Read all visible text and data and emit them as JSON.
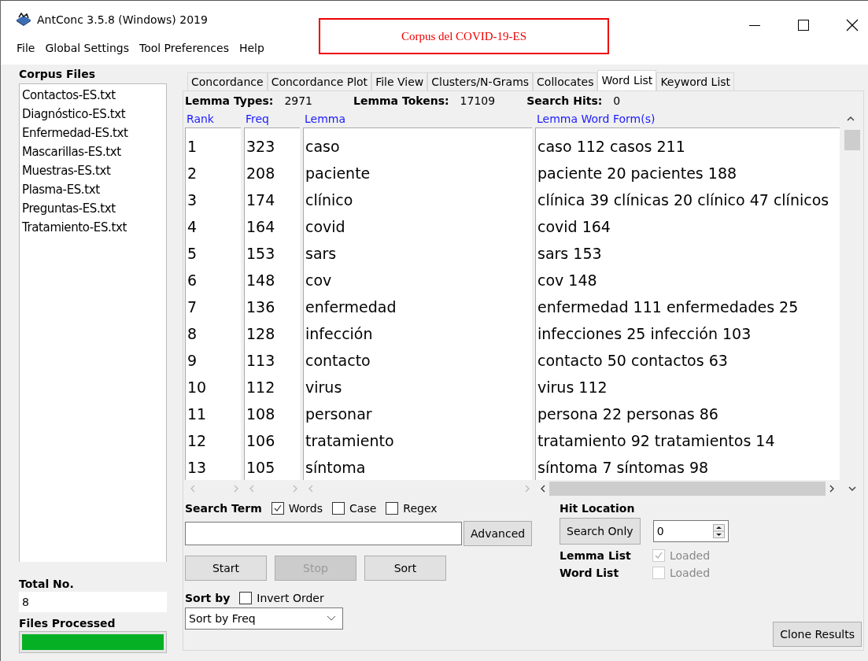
{
  "window": {
    "title": "AntConc 3.5.8 (Windows) 2019"
  },
  "annotation": "Corpus del COVID-19-ES",
  "menu": [
    "File",
    "Global Settings",
    "Tool Preferences",
    "Help"
  ],
  "corpus_files": {
    "title": "Corpus Files",
    "files": [
      "Contactos-ES.txt",
      "Diagnóstico-ES.txt",
      "Enfermedad-ES.txt",
      "Mascarillas-ES.txt",
      "Muestras-ES.txt",
      "Plasma-ES.txt",
      "Preguntas-ES.txt",
      "Tratamiento-ES.txt"
    ]
  },
  "total_no": {
    "label": "Total No.",
    "value": "8"
  },
  "files_processed": {
    "label": "Files Processed",
    "level": 1
  },
  "tabs": [
    {
      "label": "Concordance",
      "selected": false
    },
    {
      "label": "Concordance Plot",
      "selected": false
    },
    {
      "label": "File View",
      "selected": false
    },
    {
      "label": "Clusters/N-Grams",
      "selected": false
    },
    {
      "label": "Collocates",
      "selected": false
    },
    {
      "label": "Word List",
      "selected": true
    },
    {
      "label": "Keyword List",
      "selected": false
    }
  ],
  "stats": [
    {
      "label": "Lemma Types:",
      "value": "2971"
    },
    {
      "label": "Lemma Tokens:",
      "value": "17109"
    },
    {
      "label": "Search Hits:",
      "value": "0"
    }
  ],
  "table": {
    "columns": [
      "Rank",
      "Freq",
      "Lemma",
      "Lemma Word Form(s)"
    ],
    "rows": [
      [
        "1",
        "323",
        "caso",
        "caso 112 casos 211"
      ],
      [
        "2",
        "208",
        "paciente",
        "paciente 20 pacientes 188"
      ],
      [
        "3",
        "174",
        "clínico",
        "clínica 39 clínicas 20 clínico 47 clínicos"
      ],
      [
        "4",
        "164",
        "covid",
        "covid 164"
      ],
      [
        "5",
        "153",
        "sars",
        "sars 153"
      ],
      [
        "6",
        "148",
        "cov",
        "cov 148"
      ],
      [
        "7",
        "136",
        "enfermedad",
        "enfermedad 111 enfermedades 25"
      ],
      [
        "8",
        "128",
        "infección",
        "infecciones 25 infección 103"
      ],
      [
        "9",
        "113",
        "contacto",
        "contacto 50 contactos 63"
      ],
      [
        "10",
        "112",
        "virus",
        "virus 112"
      ],
      [
        "11",
        "108",
        "personar",
        "persona 22 personas 86"
      ],
      [
        "12",
        "106",
        "tratamiento",
        "tratamiento 92 tratamientos 14"
      ],
      [
        "13",
        "105",
        "síntoma",
        "síntoma 7 síntomas 98"
      ]
    ]
  },
  "search_term": {
    "label": "Search Term",
    "options": [
      {
        "label": "Words",
        "checked": true
      },
      {
        "label": "Case",
        "checked": false
      },
      {
        "label": "Regex",
        "checked": false
      }
    ],
    "advanced": "Advanced"
  },
  "actions": [
    {
      "label": "Start",
      "disabled": false
    },
    {
      "label": "Stop",
      "disabled": true
    },
    {
      "label": "Sort",
      "disabled": false
    }
  ],
  "sort_by": {
    "label": "Sort by",
    "invert": {
      "label": "Invert Order",
      "checked": false
    },
    "value": "Sort by Freq"
  },
  "hit_location": {
    "label": "Hit Location",
    "button": "Search Only",
    "value": "0"
  },
  "lists": [
    {
      "label": "Lemma List",
      "option": "Loaded",
      "checked": true
    },
    {
      "label": "Word List",
      "option": "Loaded",
      "checked": false
    }
  ],
  "clone": "Clone Results"
}
